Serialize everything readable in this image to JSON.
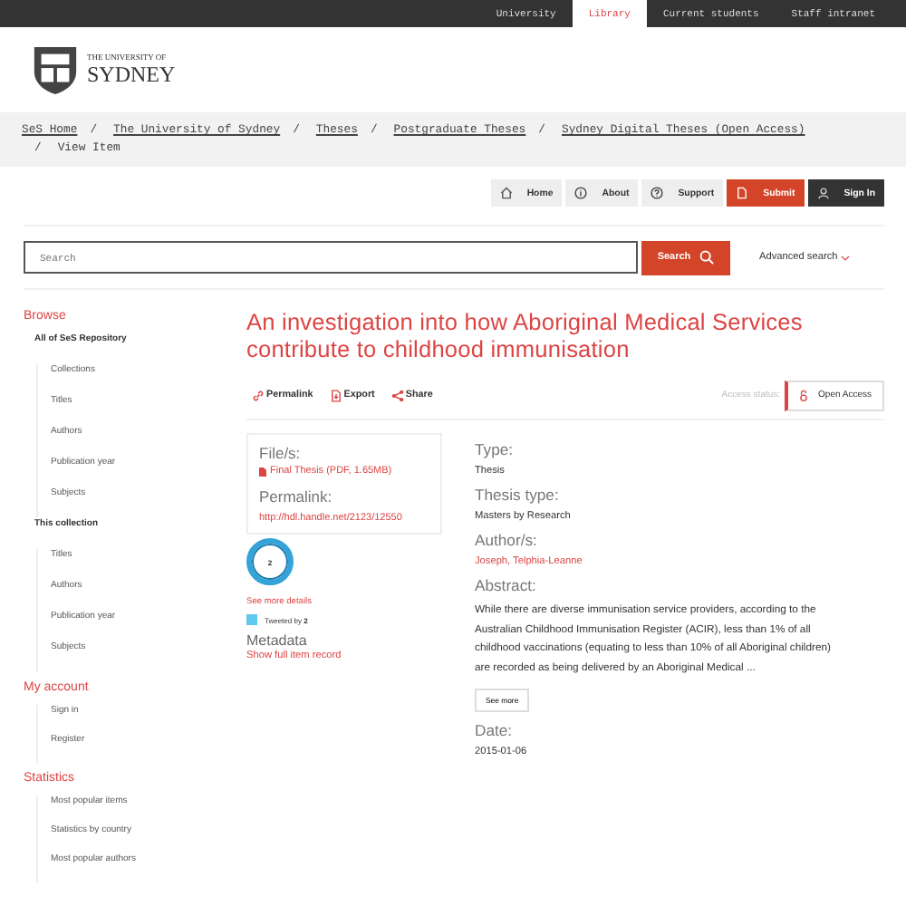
{
  "top_nav": [
    {
      "label": "University",
      "selected": false
    },
    {
      "label": "Library",
      "selected": true
    },
    {
      "label": "Current students",
      "selected": false
    },
    {
      "label": "Staff intranet",
      "selected": false
    }
  ],
  "logo": {
    "line1": "THE UNIVERSITY OF",
    "line2": "SYDNEY"
  },
  "breadcrumb": [
    {
      "label": "SeS Home",
      "current": false
    },
    {
      "separator": "/",
      "label": "The University of Sydney",
      "current": false
    },
    {
      "separator": "/",
      "label": "Theses",
      "current": false
    },
    {
      "separator": "/",
      "label": "Postgraduate Theses",
      "current": false
    },
    {
      "separator": "/",
      "label": "Sydney Digital Theses (Open Access)",
      "current": false
    },
    {
      "separator": "/",
      "label": "View Item",
      "current": true
    }
  ],
  "nav_buttons": [
    {
      "label": "Home",
      "kind": "plain"
    },
    {
      "label": "About",
      "kind": "plain"
    },
    {
      "label": "Support",
      "kind": "plain"
    },
    {
      "label": "Submit",
      "kind": "primary"
    },
    {
      "label": "Sign In",
      "kind": "dark"
    }
  ],
  "search": {
    "placeholder": "Search",
    "button": "Search",
    "advanced": "Advanced search"
  },
  "sidebar": [
    {
      "heading": "Browse",
      "groups": [
        {
          "title": "All of SeS Repository",
          "items": [
            "Collections",
            "Titles",
            "Authors",
            "Publication year",
            "Subjects"
          ]
        },
        {
          "title": "This collection",
          "items": [
            "Titles",
            "Authors",
            "Publication year",
            "Subjects"
          ]
        }
      ]
    },
    {
      "heading": "My account",
      "groups": [
        {
          "items": [
            "Sign in",
            "Register"
          ]
        }
      ]
    },
    {
      "heading": "Statistics",
      "groups": [
        {
          "items": [
            "Most popular items",
            "Statistics by country",
            "Most popular authors"
          ]
        }
      ]
    }
  ],
  "title": "An investigation into how Aboriginal Medical Services contribute to childhood immunisation",
  "actions": [
    "Permalink",
    "Export",
    "Share"
  ],
  "access": {
    "label": "Access status:",
    "value": "Open Access"
  },
  "files": {
    "heading": "File/s:",
    "file": "Final Thesis (PDF, 1.65MB)",
    "permalink_heading": "Permalink:",
    "permalink": "http://hdl.handle.net/2123/12550"
  },
  "altmetric": {
    "score": "2",
    "details": "See more details",
    "tweeted": "Tweeted by **2**"
  },
  "metadata": {
    "heading": "Metadata",
    "link": "Show full item record"
  },
  "fields": [
    {
      "label": "Type:",
      "value": "Thesis",
      "kind": "text"
    },
    {
      "label": "Thesis type:",
      "value": "Masters by Research",
      "kind": "text"
    },
    {
      "label": "Author/s:",
      "value": "Joseph, Telphia-Leanne",
      "kind": "link"
    },
    {
      "label": "Abstract:",
      "value": "While there are diverse immunisation service providers, according to the Australian Childhood Immunisation Register (ACIR), less than 1% of all childhood vaccinations (equating to less than 10% of all Aboriginal children) are recorded as being delivered by an Aboriginal Medical ...",
      "kind": "abstract",
      "more": "See more"
    },
    {
      "label": "Date:",
      "value": "2015-01-06",
      "kind": "text"
    }
  ]
}
